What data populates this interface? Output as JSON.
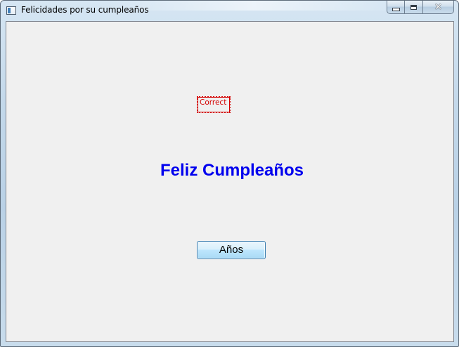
{
  "window": {
    "title": "Felicidades por su cumpleaños",
    "icon": "app-window-icon",
    "controls": {
      "minimize_icon": "minimize-icon",
      "maximize_icon": "maximize-icon",
      "close_icon": "close-icon",
      "close_glyph": "✕"
    }
  },
  "main": {
    "status_label": "Correct",
    "greeting": "Feliz Cumpleaños",
    "years_button": "Años"
  },
  "colors": {
    "status_label": "#d40000",
    "greeting": "#0000ee",
    "client_background": "#f0f0f0",
    "button_border": "#3c7fb1"
  }
}
